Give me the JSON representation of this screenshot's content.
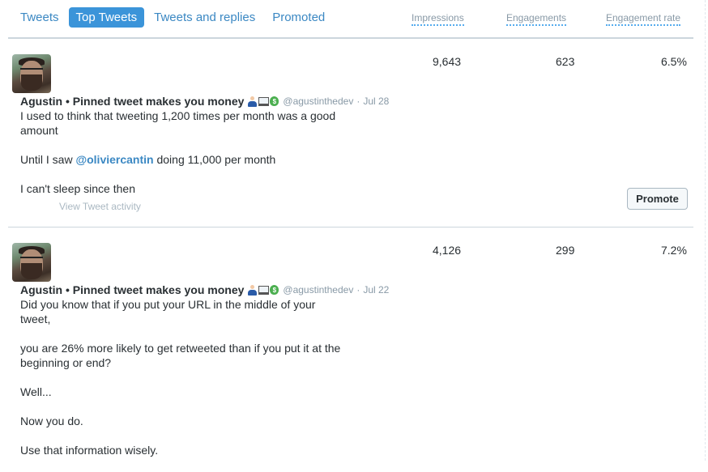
{
  "tabs": [
    {
      "label": "Tweets",
      "active": false
    },
    {
      "label": "Top Tweets",
      "active": true
    },
    {
      "label": "Tweets and replies",
      "active": false
    },
    {
      "label": "Promoted",
      "active": false
    }
  ],
  "columns": {
    "impressions": "Impressions",
    "engagements": "Engagements",
    "engagement_rate": "Engagement rate"
  },
  "tweets": [
    {
      "author_name": "Agustin • Pinned tweet makes you money",
      "emojis": [
        "person-icon",
        "laptop-icon",
        "money-bag-icon"
      ],
      "handle": "@agustinthedev",
      "separator": "·",
      "date": "Jul 28",
      "text_parts": {
        "p1": "I used to think that tweeting 1,200 times per month was a good amount",
        "p2_before": "Until I saw ",
        "p2_mention": "@oliviercantin",
        "p2_after": " doing 11,000 per month",
        "p3": "I can't sleep since then"
      },
      "view_activity": "View Tweet activity",
      "impressions": "9,643",
      "engagements": "623",
      "engagement_rate": "6.5%",
      "promote_label": "Promote"
    },
    {
      "author_name": "Agustin • Pinned tweet makes you money",
      "emojis": [
        "person-icon",
        "laptop-icon",
        "money-bag-icon"
      ],
      "handle": "@agustinthedev",
      "separator": "·",
      "date": "Jul 22",
      "paragraphs": [
        "Did you know that if you put your URL in the middle of your tweet,",
        "you are 26% more likely to get retweeted than if you put it at the beginning or end?",
        "Well...",
        "Now you do.",
        "Use that information wisely."
      ],
      "impressions": "4,126",
      "engagements": "299",
      "engagement_rate": "7.2%"
    }
  ],
  "colors": {
    "accent": "#3b94d9",
    "link": "#3b88c3",
    "muted": "#8899a6"
  }
}
